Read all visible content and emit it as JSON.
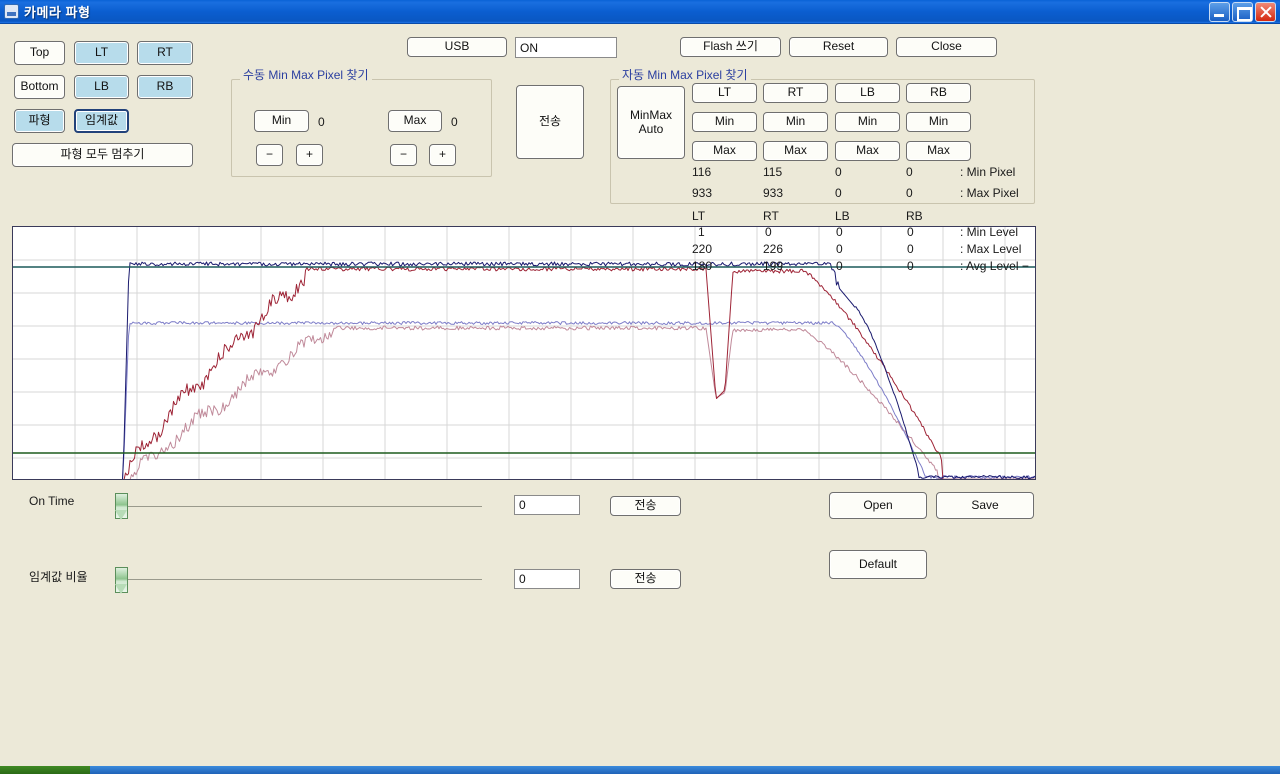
{
  "window": {
    "title": "카메라 파형",
    "icon": "window-icon",
    "minimize_label": "Minimize",
    "maximize_label": "Maximize",
    "close_label": "Close"
  },
  "left_panel": {
    "buttons": [
      {
        "label": "Top",
        "style": "plain"
      },
      {
        "label": "LT",
        "style": "blue"
      },
      {
        "label": "RT",
        "style": "blue"
      },
      {
        "label": "Bottom",
        "style": "plain"
      },
      {
        "label": "LB",
        "style": "blue"
      },
      {
        "label": "RB",
        "style": "blue"
      },
      {
        "label": "파형",
        "style": "blue"
      },
      {
        "label": "임계값",
        "style": "focus"
      }
    ],
    "stop_all_label": "파형 모두 멈추기"
  },
  "toolbar": {
    "usb_label": "USB",
    "status_value": "ON",
    "flash_write_label": "Flash 쓰기",
    "reset_label": "Reset",
    "close_label": "Close"
  },
  "manual_group": {
    "title": "수동 Min Max  Pixel 찾기",
    "min_label": "Min",
    "min_value": "0",
    "max_label": "Max",
    "max_value": "0",
    "min_minus_label": "−",
    "min_plus_label": "+",
    "max_minus_label": "−",
    "max_plus_label": "+"
  },
  "send_button": {
    "label": "전송"
  },
  "auto_group": {
    "title": "자동 Min Max  Pixel 찾기",
    "minmax_auto_label": "MinMax\nAuto",
    "channels": [
      "LT",
      "RT",
      "LB",
      "RB"
    ],
    "min_label": "Min",
    "max_label": "Max",
    "min_pixel_caption": ": Min Pixel",
    "max_pixel_caption": ": Max Pixel",
    "min_pixel": [
      "116",
      "115",
      "0",
      "0"
    ],
    "max_pixel": [
      "933",
      "933",
      "0",
      "0"
    ]
  },
  "levels": {
    "headers": [
      "LT",
      "RT",
      "LB",
      "RB"
    ],
    "min_caption": ": Min Level",
    "max_caption": ": Max Level",
    "avg_caption": ": Avg Level −",
    "min_level": [
      "1",
      "0",
      "0",
      "0"
    ],
    "max_level": [
      "220",
      "226",
      "0",
      "0"
    ],
    "avg_level": [
      "180",
      "199",
      "0",
      "0"
    ]
  },
  "sliders": [
    {
      "label": "On Time",
      "value": "0",
      "send_label": "전송",
      "position_pct": 0
    },
    {
      "label": "임계값 비율",
      "value": "0",
      "send_label": "전송",
      "position_pct": 0
    }
  ],
  "file_buttons": {
    "open_label": "Open",
    "save_label": "Save",
    "default_label": "Default"
  },
  "chart_data": {
    "type": "line",
    "title": "",
    "xlabel": "",
    "ylabel": "",
    "grid": true,
    "xlim": [
      0,
      1024
    ],
    "ylim": [
      0,
      254
    ],
    "gridlines_x": [
      62,
      124,
      186,
      248,
      310,
      372,
      434,
      496,
      558,
      620,
      682,
      744,
      806,
      868,
      930,
      992
    ],
    "gridlines_y": [
      33,
      66,
      99,
      132,
      165,
      198,
      231
    ],
    "threshold_lines": [
      {
        "name": "upper-threshold",
        "y": 40,
        "color": "#1c5a5a"
      },
      {
        "name": "lower-threshold",
        "y": 226,
        "color": "#1d5c1d"
      }
    ],
    "series": [
      {
        "name": "LT Max (navy)",
        "color": "#1a1a6e",
        "width": 1.0
      },
      {
        "name": "RT Max (red)",
        "color": "#9e2436",
        "width": 1.0
      },
      {
        "name": "LT Avg (blue)",
        "color": "#7d7dc8",
        "width": 1.0
      },
      {
        "name": "RT Avg (pink)",
        "color": "#c08a9a",
        "width": 1.0
      }
    ],
    "legend_position": "none",
    "annotations": [
      "Rising edge for navy series at x≈112",
      "Rising ramp for red series from x≈112 to x≈300",
      "Notch dip in red series near x≈700",
      "Falling edges near x≈820-930"
    ]
  }
}
